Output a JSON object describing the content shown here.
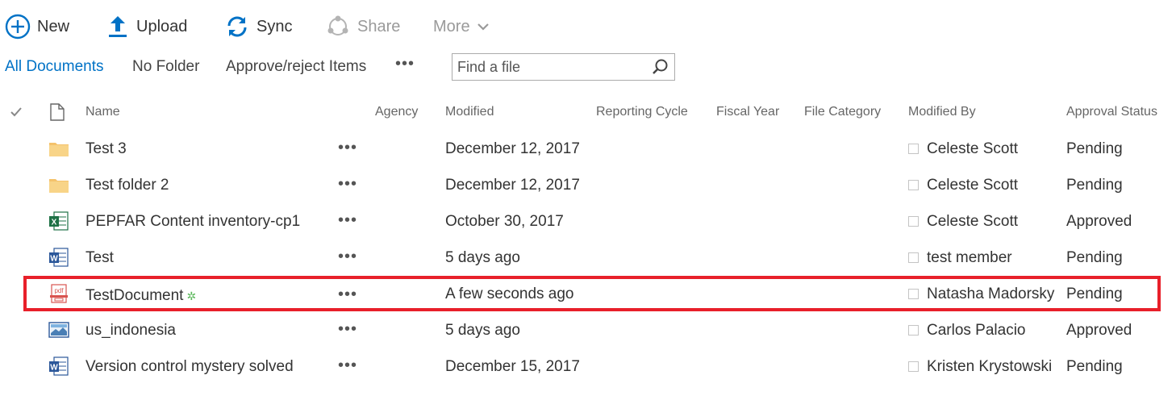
{
  "toolbar": {
    "new_label": "New",
    "upload_label": "Upload",
    "sync_label": "Sync",
    "share_label": "Share",
    "more_label": "More"
  },
  "views": {
    "all_documents": "All Documents",
    "no_folder": "No Folder",
    "approve_reject": "Approve/reject Items",
    "ellipsis": "•••",
    "search_placeholder": "Find a file"
  },
  "columns": {
    "name": "Name",
    "agency": "Agency",
    "modified": "Modified",
    "reporting_cycle": "Reporting Cycle",
    "fiscal_year": "Fiscal Year",
    "file_category": "File Category",
    "modified_by": "Modified By",
    "approval_status": "Approval Status"
  },
  "rows": [
    {
      "type": "folder",
      "name": "Test 3",
      "modified": "December 12, 2017",
      "modified_by": "Celeste Scott",
      "status": "Pending"
    },
    {
      "type": "folder",
      "name": "Test folder 2",
      "modified": "December 12, 2017",
      "modified_by": "Celeste Scott",
      "status": "Pending"
    },
    {
      "type": "excel",
      "name": "PEPFAR Content inventory-cp1",
      "modified": "October 30, 2017",
      "modified_by": "Celeste Scott",
      "status": "Approved"
    },
    {
      "type": "word",
      "name": "Test",
      "modified": "5 days ago",
      "modified_by": "test member",
      "status": "Pending"
    },
    {
      "type": "pdf",
      "name": "TestDocument",
      "modified": "A few seconds ago",
      "modified_by": "Natasha Madorsky",
      "status": "Pending",
      "is_new": true
    },
    {
      "type": "image",
      "name": "us_indonesia",
      "modified": "5 days ago",
      "modified_by": "Carlos Palacio",
      "status": "Approved"
    },
    {
      "type": "word",
      "name": "Version control mystery solved",
      "modified": "December 15, 2017",
      "modified_by": "Kristen Krystowski",
      "status": "Pending"
    }
  ],
  "colors": {
    "accent": "#0072c6",
    "highlight": "#e8202a"
  }
}
